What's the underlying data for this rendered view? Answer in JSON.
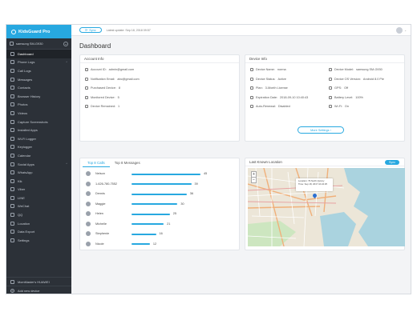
{
  "brand": {
    "name": "KidsGuard Pro"
  },
  "device": {
    "name": "samsung SM-G930"
  },
  "sidebar": {
    "items": [
      {
        "label": "Dashboard",
        "icon": "dashboard-icon",
        "active": true
      },
      {
        "label": "Phone Logs",
        "icon": "phone-icon",
        "arrow": "^"
      },
      {
        "label": "Call Logs",
        "icon": "call-icon"
      },
      {
        "label": "Messages",
        "icon": "message-icon"
      },
      {
        "label": "Contacts",
        "icon": "contacts-icon"
      },
      {
        "label": "Browser History",
        "icon": "browser-icon"
      },
      {
        "label": "Photos",
        "icon": "photo-icon"
      },
      {
        "label": "Videos",
        "icon": "video-icon"
      },
      {
        "label": "Capture Screenshots",
        "icon": "screenshot-icon"
      },
      {
        "label": "Installed Apps",
        "icon": "apps-icon"
      },
      {
        "label": "Wi-Fi Logger",
        "icon": "wifi-icon"
      },
      {
        "label": "Keylogger",
        "icon": "keyboard-icon"
      },
      {
        "label": "Calendar",
        "icon": "calendar-icon"
      },
      {
        "label": "Social Apps",
        "icon": "social-icon",
        "arrow": "^"
      },
      {
        "label": "WhatsApp",
        "icon": "whatsapp-icon"
      },
      {
        "label": "Kik",
        "icon": "kik-icon"
      },
      {
        "label": "Viber",
        "icon": "viber-icon"
      },
      {
        "label": "LINE",
        "icon": "line-icon"
      },
      {
        "label": "WeChat",
        "icon": "wechat-icon"
      },
      {
        "label": "QQ",
        "icon": "qq-icon"
      },
      {
        "label": "Location",
        "icon": "location-icon"
      },
      {
        "label": "Data Export",
        "icon": "export-icon"
      },
      {
        "label": "Settings",
        "icon": "settings-icon"
      }
    ],
    "bottom": [
      {
        "label": "MomMaster's HUAWEI",
        "icon": "device-icon"
      },
      {
        "label": "Add new device",
        "icon": "plus-icon"
      }
    ]
  },
  "topbar": {
    "sync_label": "Sync",
    "latest_update": "Latest update: Sep 18, 2018 09:57"
  },
  "page": {
    "title": "Dashboard"
  },
  "account_info": {
    "title": "Account Info",
    "rows": [
      {
        "label": "Account ID:",
        "value": "admin@gmail.com",
        "icon": "user-icon"
      },
      {
        "label": "Notification Email:",
        "value": "abc@gmail.com",
        "icon": "mail-icon"
      },
      {
        "label": "Purchased Device:",
        "value": "8",
        "icon": "device-icon"
      },
      {
        "label": "Monitored Device:",
        "value": "5",
        "icon": "monitor-icon"
      },
      {
        "label": "Device Remained:",
        "value": "1",
        "icon": "remain-icon"
      }
    ]
  },
  "device_info": {
    "title": "Device Info",
    "left_rows": [
      {
        "label": "Device Name:",
        "value": "norma",
        "icon": "phone-icon"
      },
      {
        "label": "Device Status:",
        "value": "Active",
        "icon": "status-icon"
      },
      {
        "label": "Plan:",
        "value": "3-Month License",
        "icon": "plan-icon"
      },
      {
        "label": "Expiration Date:",
        "value": "2018-09-10 10:40:43",
        "icon": "clock-icon"
      },
      {
        "label": "Auto-Renewal:",
        "value": "Disabled",
        "icon": "renew-icon"
      }
    ],
    "right_rows": [
      {
        "label": "Device Model:",
        "value": "samsung SM-G930",
        "icon": "phone-icon"
      },
      {
        "label": "Device OS Version:",
        "value": "Android 8.0 Pie",
        "icon": "android-icon"
      },
      {
        "label": "GPS:",
        "value": "Off",
        "icon": "gps-icon"
      },
      {
        "label": "Battery Level:",
        "value": "100%",
        "icon": "battery-icon"
      },
      {
        "label": "Wi-Fi:",
        "value": "On",
        "icon": "wifi-icon"
      }
    ],
    "more_label": "More Settings"
  },
  "top_calls": {
    "tabs": [
      "Top 8 Calls",
      "Top 8 Messages"
    ],
    "max": 45,
    "rows": [
      {
        "name": "Nelson",
        "value": 45
      },
      {
        "name": "1-626-780-7552",
        "value": 39
      },
      {
        "name": "Dennis",
        "value": 36
      },
      {
        "name": "Maggie",
        "value": 30
      },
      {
        "name": "Helen",
        "value": 25
      },
      {
        "name": "Michelle",
        "value": 21
      },
      {
        "name": "Stephenie",
        "value": 16
      },
      {
        "name": "Nicole",
        "value": 12
      }
    ]
  },
  "location": {
    "title": "Last Known Location",
    "sync_label": "Sync",
    "popup_line1": "Location: 79 North Quincy",
    "popup_line2": "Time: Sep 18, 2017 10:24:25",
    "zoom_in": "+",
    "zoom_out": "−"
  }
}
